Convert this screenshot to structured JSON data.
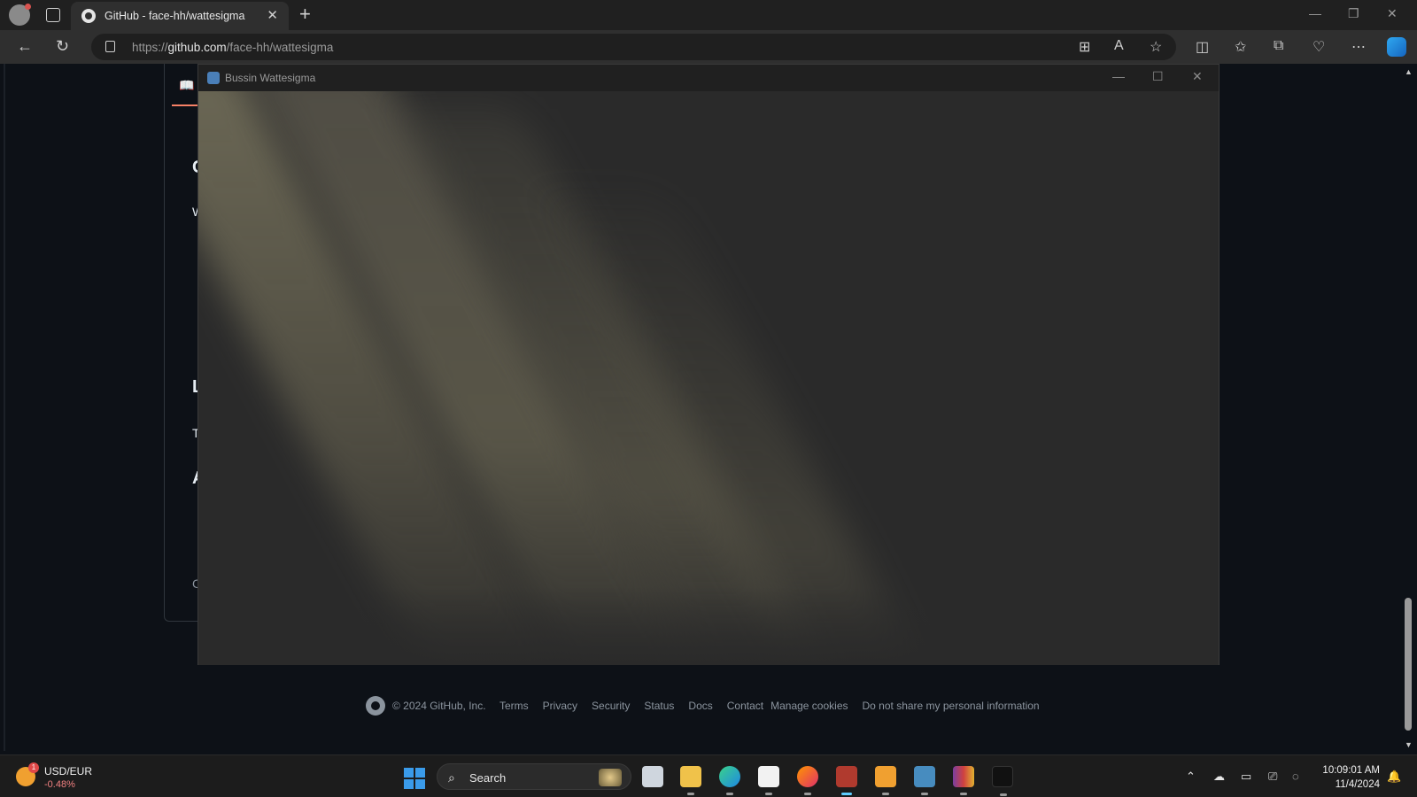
{
  "browser": {
    "tab_title": "GitHub - face-hh/wattesigma",
    "tab_close": "✕",
    "new_tab": "+",
    "url_scheme": "https://",
    "url_host": "github.com",
    "url_path": "/face-hh/wattesigma",
    "icons": [
      "profile-icon",
      "tab-actions-icon",
      "back-icon",
      "refresh-icon",
      "lock-icon",
      "app-available-icon",
      "read-aloud-icon",
      "favorite-star-icon",
      "split-screen-icon",
      "favorites-icon",
      "collections-icon",
      "browser-essentials-icon",
      "more-icon",
      "copilot-icon"
    ]
  },
  "page": {
    "repo_fragments": [
      "C",
      "W",
      "L",
      "T",
      "A",
      "C"
    ],
    "footer": {
      "copyright": "© 2024 GitHub, Inc.",
      "links": [
        "Terms",
        "Privacy",
        "Security",
        "Status",
        "Docs",
        "Contact",
        "Manage cookies",
        "Do not share my personal information"
      ]
    }
  },
  "app_window": {
    "title": "Bussin Wattesigma"
  },
  "taskbar": {
    "widget_name": "USD/EUR",
    "widget_value": "-0.48%",
    "widget_badge": "1",
    "search_label": "Search",
    "time": "10:09:01 AM",
    "date": "11/4/2024",
    "apps": [
      "task-view",
      "file-explorer",
      "edge",
      "microsoft-store",
      "firefox",
      "app-red",
      "media-player",
      "godot",
      "winrar",
      "tiktok"
    ]
  },
  "colors": {
    "accent": "#f78166",
    "page_bg": "#0d1117",
    "taskbar_bg": "#1c1c1c"
  }
}
